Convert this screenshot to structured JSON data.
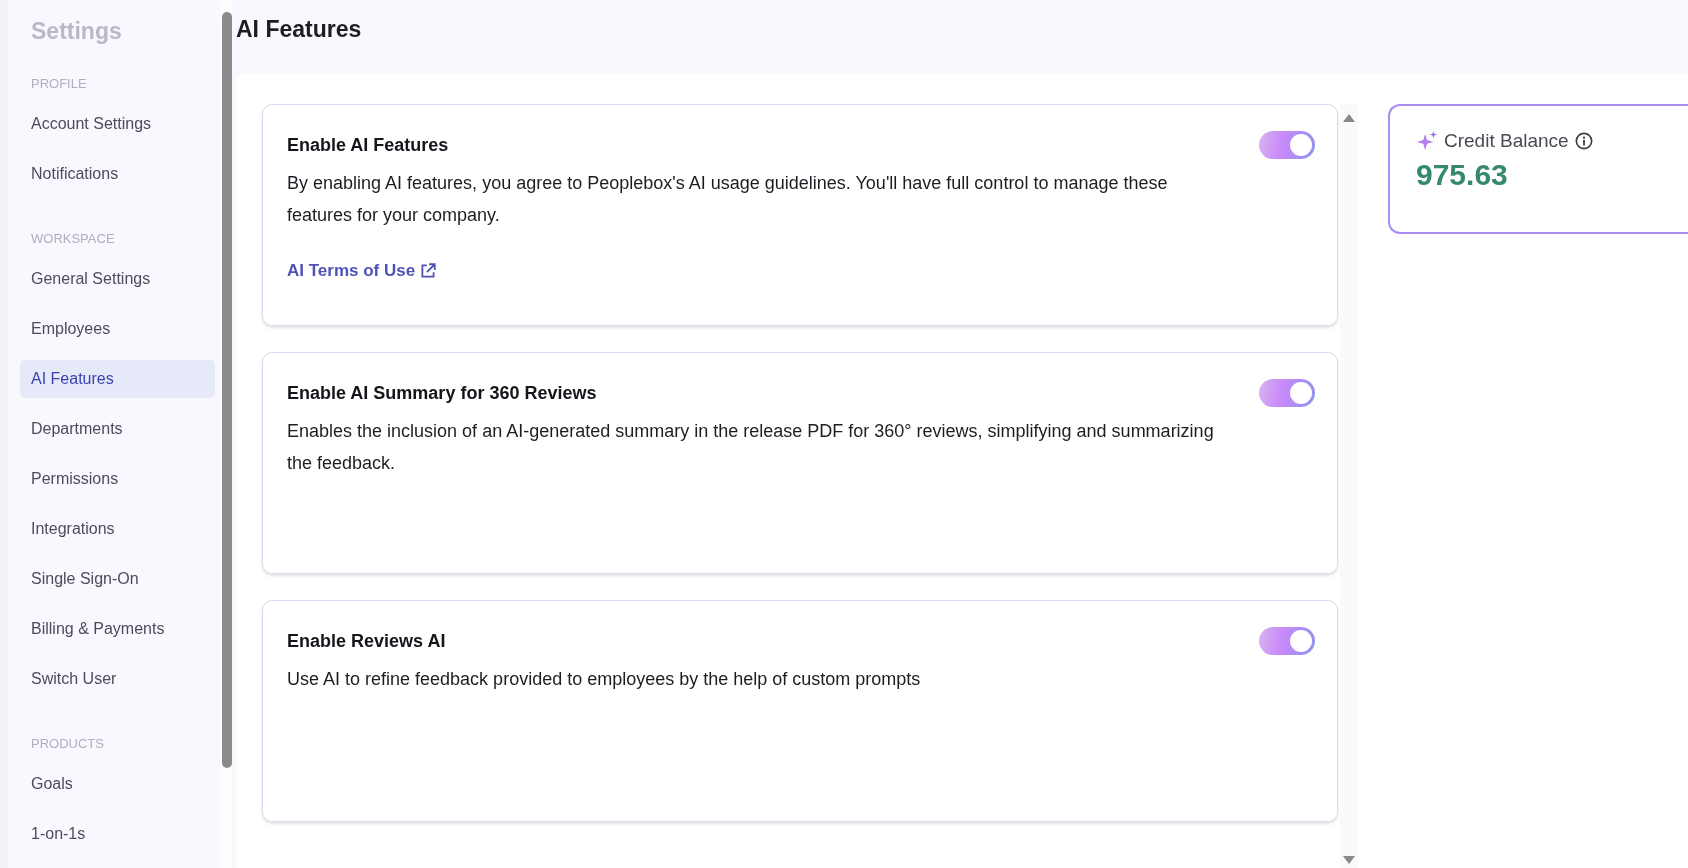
{
  "sidebar": {
    "title": "Settings",
    "sections": [
      {
        "label": "PROFILE",
        "items": [
          {
            "label": "Account Settings",
            "selected": false
          },
          {
            "label": "Notifications",
            "selected": false
          }
        ]
      },
      {
        "label": "WORKSPACE",
        "items": [
          {
            "label": "General Settings",
            "selected": false
          },
          {
            "label": "Employees",
            "selected": false
          },
          {
            "label": "AI Features",
            "selected": true
          },
          {
            "label": "Departments",
            "selected": false
          },
          {
            "label": "Permissions",
            "selected": false
          },
          {
            "label": "Integrations",
            "selected": false
          },
          {
            "label": "Single Sign-On",
            "selected": false
          },
          {
            "label": "Billing & Payments",
            "selected": false
          },
          {
            "label": "Switch User",
            "selected": false
          }
        ]
      },
      {
        "label": "PRODUCTS",
        "items": [
          {
            "label": "Goals",
            "selected": false
          },
          {
            "label": "1-on-1s",
            "selected": false
          }
        ]
      }
    ]
  },
  "page_title": "AI Features",
  "features": [
    {
      "title": "Enable AI Features",
      "on": true,
      "description": "By enabling AI features, you agree to Peoplebox's AI usage guidelines. You'll have full control to manage these features for your company.",
      "link": "AI Terms of Use"
    },
    {
      "title": "Enable AI Summary for 360 Reviews",
      "on": true,
      "description": "Enables the inclusion of an AI-generated summary in the release PDF for 360° reviews, simplifying and summarizing the feedback."
    },
    {
      "title": "Enable Reviews AI",
      "on": true,
      "description": "Use AI to refine feedback provided to employees by the help of custom prompts"
    }
  ],
  "credit_balance": {
    "label": "Credit Balance",
    "value": "975.63"
  }
}
